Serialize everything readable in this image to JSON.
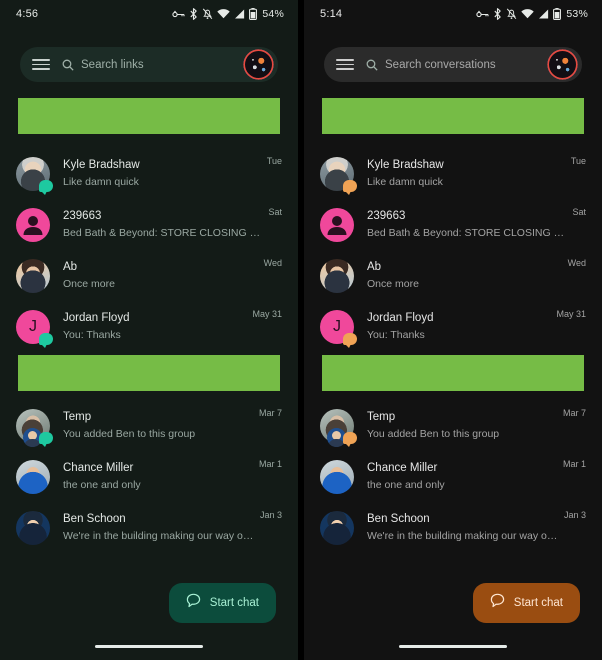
{
  "panels": [
    {
      "key": "left",
      "status": {
        "time": "4:56",
        "battery": "54%",
        "icons": [
          "vpn-key-icon",
          "bluetooth-icon",
          "notifications-off-icon",
          "wifi-icon",
          "cell-signal-icon",
          "battery-icon"
        ]
      },
      "search": {
        "placeholder": "Search links"
      },
      "fab": {
        "label": "Start chat"
      },
      "accent": "#0c4c3c",
      "badge_color": "#1ec9a0",
      "rows_top": [
        {
          "name": "Kyle Bradshaw",
          "snippet": "Like damn quick",
          "time": "Tue",
          "avatar": "photo-kyle",
          "badge": true
        },
        {
          "name": "239663",
          "snippet": "Bed Bath & Beyond: STORE CLOSING SALE! New ite...",
          "time": "Sat",
          "avatar": "person-pink",
          "badge": false
        },
        {
          "name": "Ab",
          "snippet": "Once more",
          "time": "Wed",
          "avatar": "photo-ab",
          "badge": false
        },
        {
          "name": "Jordan Floyd",
          "snippet": "You: Thanks",
          "time": "May 31",
          "avatar": "initial-J",
          "badge": true
        }
      ],
      "rows_bottom": [
        {
          "name": "Temp",
          "snippet": "You added Ben to this group",
          "time": "Mar 7",
          "avatar": "photo-temp",
          "badge": true,
          "group": true
        },
        {
          "name": "Chance Miller",
          "snippet": "the one and only",
          "time": "Mar 1",
          "avatar": "photo-chance",
          "badge": false
        },
        {
          "name": "Ben Schoon",
          "snippet": "We're in the building making our way over",
          "time": "Jan 3",
          "avatar": "photo-ben",
          "badge": false
        }
      ]
    },
    {
      "key": "right",
      "status": {
        "time": "5:14",
        "battery": "53%",
        "icons": [
          "vpn-key-icon",
          "bluetooth-icon",
          "notifications-off-icon",
          "wifi-icon",
          "cell-signal-icon",
          "battery-icon"
        ]
      },
      "search": {
        "placeholder": "Search conversations"
      },
      "fab": {
        "label": "Start chat"
      },
      "accent": "#9a4d11",
      "badge_color": "#f0a355",
      "rows_top": [
        {
          "name": "Kyle Bradshaw",
          "snippet": "Like damn quick",
          "time": "Tue",
          "avatar": "photo-kyle",
          "badge": true
        },
        {
          "name": "239663",
          "snippet": "Bed Bath & Beyond: STORE CLOSING SALE! New ite...",
          "time": "Sat",
          "avatar": "person-pink",
          "badge": false
        },
        {
          "name": "Ab",
          "snippet": "Once more",
          "time": "Wed",
          "avatar": "photo-ab",
          "badge": false
        },
        {
          "name": "Jordan Floyd",
          "snippet": "You: Thanks",
          "time": "May 31",
          "avatar": "initial-J",
          "badge": true
        }
      ],
      "rows_bottom": [
        {
          "name": "Temp",
          "snippet": "You added Ben to this group",
          "time": "Mar 7",
          "avatar": "photo-temp",
          "badge": true,
          "group": true
        },
        {
          "name": "Chance Miller",
          "snippet": "the one and only",
          "time": "Mar 1",
          "avatar": "photo-chance",
          "badge": false
        },
        {
          "name": "Ben Schoon",
          "snippet": "We're in the building making our way over",
          "time": "Jan 3",
          "avatar": "photo-ben",
          "badge": false
        }
      ]
    }
  ],
  "colors": {
    "banner_green": "#76bc46",
    "pink_avatar": "#f0489b"
  }
}
